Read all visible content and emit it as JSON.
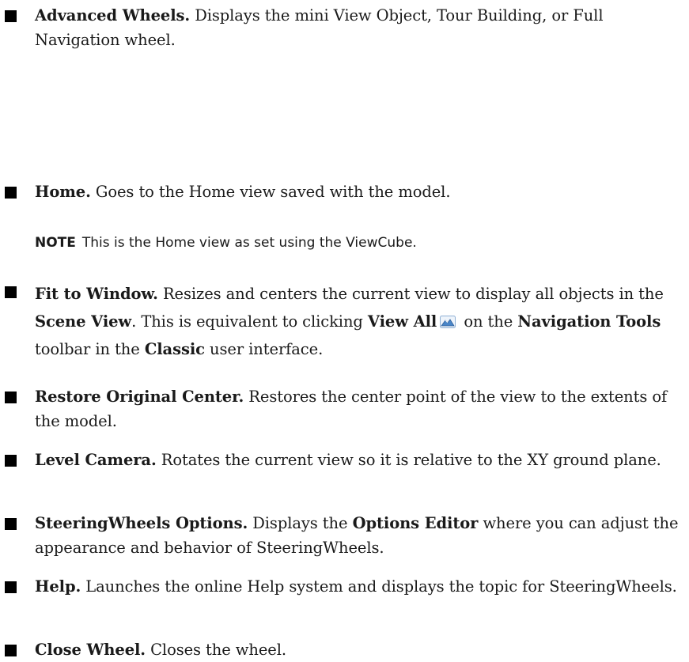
{
  "items": [
    {
      "title": "Advanced Wheels.",
      "desc": "Displays the mini View Object, Tour Building, or Full Navigation wheel."
    },
    {
      "title": "Home.",
      "desc": "Goes to the Home view saved with the model."
    },
    {
      "title": "Fit to Window.",
      "p1": "Resizes and centers the current view to display all objects in the",
      "b1": "Scene View",
      "p2": ". This is equivalent to clicking",
      "b2": "View All",
      "p3": "on the",
      "b3": "Navigation Tools",
      "p4": "toolbar in the",
      "b4": "Classic",
      "p5": "user interface."
    },
    {
      "title": "Restore Original Center.",
      "desc": "Restores the center point of the view to the extents of the model."
    },
    {
      "title": "Level Camera.",
      "desc": "Rotates the current view so it is relative to the XY ground plane."
    },
    {
      "title": "SteeringWheels Options.",
      "p1": "Displays the",
      "b1": "Options Editor",
      "p2": "where you can adjust the appearance and behavior of SteeringWheels."
    },
    {
      "title": "Help.",
      "desc": "Launches the online Help system and displays the topic for SteeringWheels."
    },
    {
      "title": "Close Wheel.",
      "desc": "Closes the wheel."
    }
  ],
  "note": {
    "label": "NOTE",
    "text": "This is the Home view as set using the ViewCube."
  },
  "icons": {
    "view_all": "view-all-icon"
  }
}
